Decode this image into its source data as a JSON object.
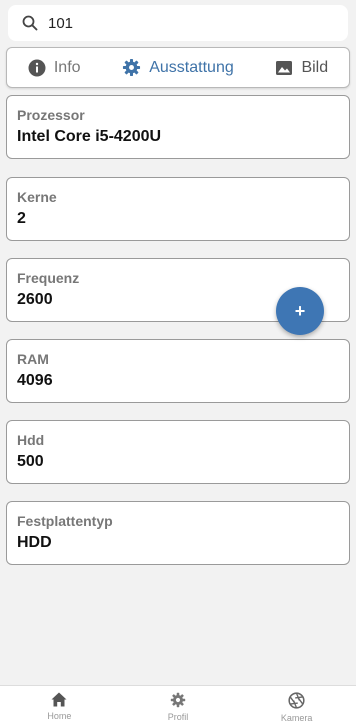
{
  "search": {
    "value": "101"
  },
  "tabs": [
    {
      "label": "Info",
      "icon": "info-icon"
    },
    {
      "label": "Ausstattung",
      "icon": "gear-icon",
      "active": true
    },
    {
      "label": "Bild",
      "icon": "image-icon"
    }
  ],
  "fields": [
    {
      "label": "Prozessor",
      "value": "Intel Core i5-4200U"
    },
    {
      "label": "Kerne",
      "value": "2"
    },
    {
      "label": "Frequenz",
      "value": "2600"
    },
    {
      "label": "RAM",
      "value": "4096"
    },
    {
      "label": "Hdd",
      "value": "500"
    },
    {
      "label": "Festplattentyp",
      "value": "HDD"
    }
  ],
  "fab": {
    "label": "+"
  },
  "bottom_nav": [
    {
      "label": "Home",
      "icon": "home-icon"
    },
    {
      "label": "Profil",
      "icon": "gear-icon"
    },
    {
      "label": "Kamera",
      "icon": "aperture-icon"
    }
  ],
  "colors": {
    "accent": "#3f73a8",
    "fab": "#3e76b4",
    "background": "#f2f2f2"
  }
}
